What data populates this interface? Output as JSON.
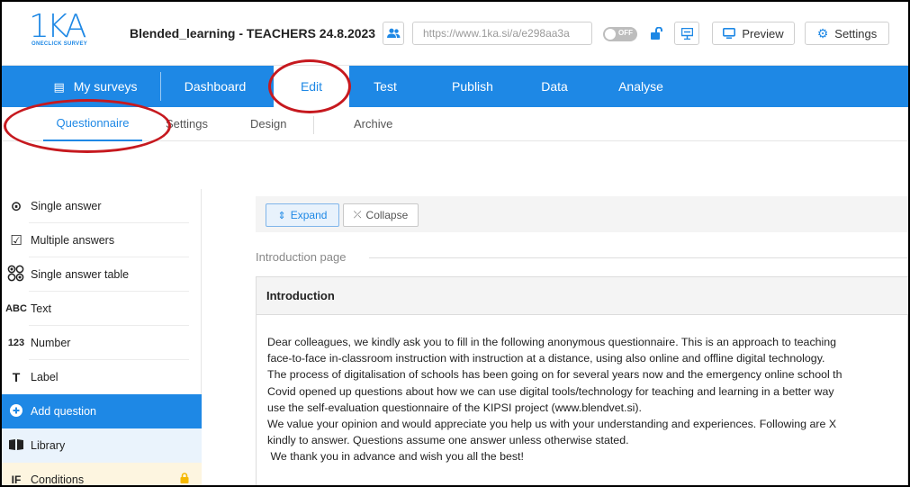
{
  "header": {
    "logo_text": "1KA",
    "logo_sub": "ONECLICK SURVEY",
    "survey_title": "Blended_learning - TEACHERS 24.8.2023",
    "url_value": "https://www.1ka.si/a/e298aa3a",
    "toggle_label": "OFF",
    "preview_label": "Preview",
    "settings_label": "Settings"
  },
  "nav": {
    "my_surveys": "My surveys",
    "items": [
      "Dashboard",
      "Edit",
      "Test",
      "Publish",
      "Data",
      "Analyse"
    ]
  },
  "subtabs": [
    "Questionnaire",
    "Settings",
    "Design",
    "Archive"
  ],
  "sidebar": {
    "items": [
      {
        "icon": "⊙",
        "label": "Single answer"
      },
      {
        "icon": "☑",
        "label": "Multiple answers"
      },
      {
        "icon": "⁘",
        "label": "Single answer table"
      },
      {
        "icon": "ABC",
        "label": "Text"
      },
      {
        "icon": "123",
        "label": "Number"
      },
      {
        "icon": "T",
        "label": "Label"
      },
      {
        "icon": "+",
        "label": "Add question"
      },
      {
        "icon": "▮▮",
        "label": "Library"
      },
      {
        "icon": "IF",
        "label": "Conditions"
      }
    ]
  },
  "toolbar": {
    "expand_label": "Expand",
    "collapse_label": "Collapse"
  },
  "main": {
    "section_title": "Introduction page",
    "card_title": "Introduction",
    "lines": [
      "Dear colleagues, we kindly ask you to fill in the following anonymous questionnaire. This is an approach to teaching",
      "face-to-face in-classroom instruction with instruction at a distance, using also online and offline digital technology.",
      "The process of digitalisation of schools has been going on for several years now and the emergency online school th",
      "Covid opened up questions about how we can use digital tools/technology for teaching and learning in a better way",
      "use the self-evaluation questionnaire of the KIPSI project (www.blendvet.si).",
      "We value your opinion and would appreciate you help us with your understanding and experiences. Following are X",
      "kindly to answer. Questions assume one answer unless otherwise stated.",
      " We thank you in advance and wish you all the best!"
    ]
  },
  "colors": {
    "brand_blue": "#1e88e5",
    "annotation_red": "#c6191f",
    "lock_yellow": "#f5b800"
  }
}
